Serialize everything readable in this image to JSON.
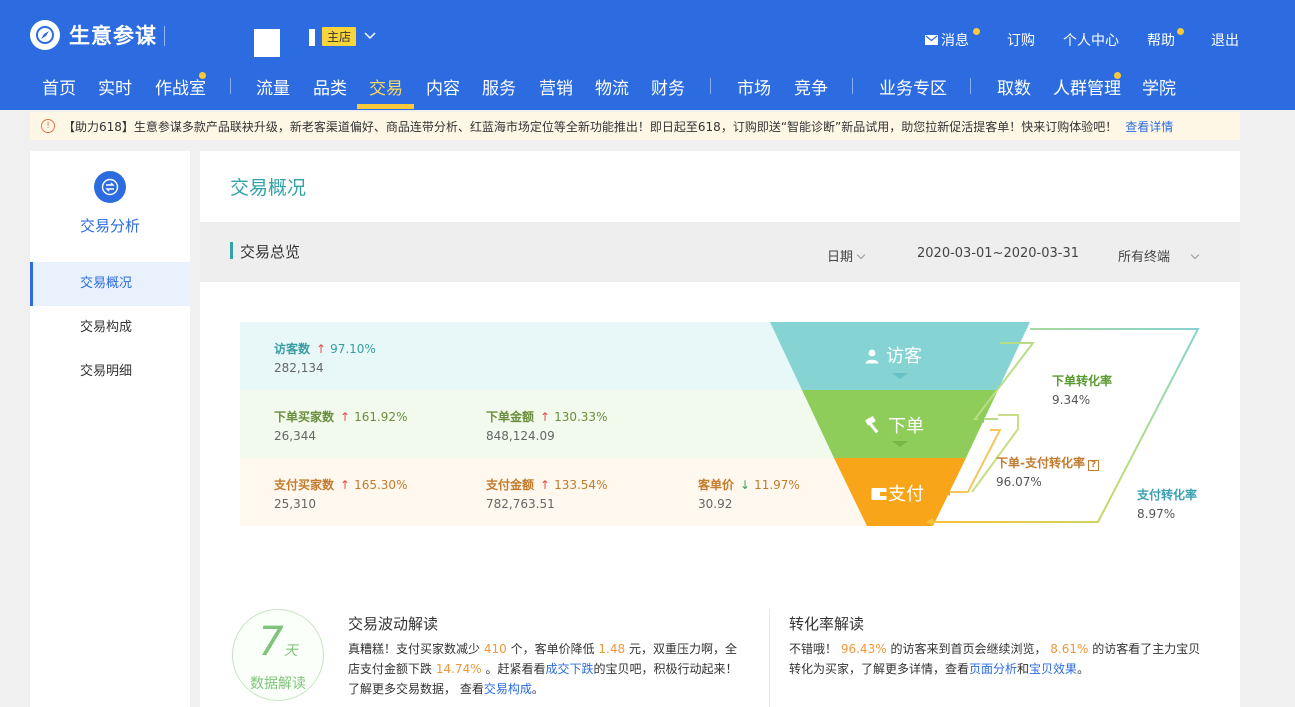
{
  "header": {
    "brand": "生意参谋",
    "shop_badge": "主店",
    "top_links": [
      "消息",
      "订购",
      "个人中心",
      "帮助",
      "退出"
    ]
  },
  "nav": {
    "items": [
      "首页",
      "实时",
      "作战室",
      "流量",
      "品类",
      "交易",
      "内容",
      "服务",
      "营销",
      "物流",
      "财务",
      "市场",
      "竞争",
      "业务专区",
      "取数",
      "人群管理",
      "学院"
    ],
    "active": "交易"
  },
  "notice": {
    "text": "【助力618】生意参谋多款产品联袂升级，新老客渠道偏好、商品连带分析、红蓝海市场定位等全新功能推出！即日起至618，订购即送“智能诊断”新品试用，助您拉新促活提客单！快来订购体验吧！",
    "link": "查看详情"
  },
  "sidebar": {
    "title": "交易分析",
    "items": [
      "交易概况",
      "交易构成",
      "交易明细"
    ]
  },
  "main": {
    "page_title": "交易概况",
    "section_title": "交易总览",
    "date_label": "日期",
    "date_range": "2020-03-01~2020-03-31",
    "terminal": "所有终端"
  },
  "metrics": {
    "visitors": {
      "label": "访客数",
      "pct": "97.10%",
      "value": "282,134"
    },
    "order_buyers": {
      "label": "下单买家数",
      "pct": "161.92%",
      "value": "26,344"
    },
    "order_amount": {
      "label": "下单金额",
      "pct": "130.33%",
      "value": "848,124.09"
    },
    "pay_buyers": {
      "label": "支付买家数",
      "pct": "165.30%",
      "value": "25,310"
    },
    "pay_amount": {
      "label": "支付金额",
      "pct": "133.54%",
      "value": "782,763.51"
    },
    "avg_price": {
      "label": "客单价",
      "pct": "11.97%",
      "value": "30.92"
    }
  },
  "funnel": {
    "visit": "访客",
    "order": "下单",
    "pay": "支付",
    "colors": {
      "visit": "#86d3d3",
      "order": "#8fcd5a",
      "pay": "#f9a51a"
    }
  },
  "conversion": {
    "order_rate_label": "下单转化率",
    "order_rate": "9.34%",
    "order_pay_label": "下单-支付转化率",
    "order_pay": "96.07%",
    "pay_rate_label": "支付转化率",
    "pay_rate": "8.97%"
  },
  "badge": {
    "num": "7",
    "unit": "天",
    "text": "数据解读"
  },
  "wave": {
    "title": "交易波动解读",
    "p1": "真糟糕！支付买家数减少",
    "v1": "410",
    "p2": "个，客单价降低",
    "v2": "1.48",
    "p3": "元，双重压力啊，全店支付金额下跌",
    "v3": "14.74%",
    "p4": "。赶紧看看",
    "link1": "成交下跌",
    "p5": "的宝贝吧，积极行动起来！",
    "p6": "了解更多交易数据，  查看",
    "link2": "交易构成",
    "p7": "。"
  },
  "conv_panel": {
    "title": "转化率解读",
    "p1": "不错哦！",
    "v1": "96.43%",
    "p2": "的访客来到首页会继续浏览，",
    "v2": "8.61%",
    "p3": "的访客看了主力宝贝转化为买家，了解更多详情，查看",
    "link1": "页面分析",
    "p4": "和",
    "link2": "宝贝效果",
    "p5": "。"
  }
}
